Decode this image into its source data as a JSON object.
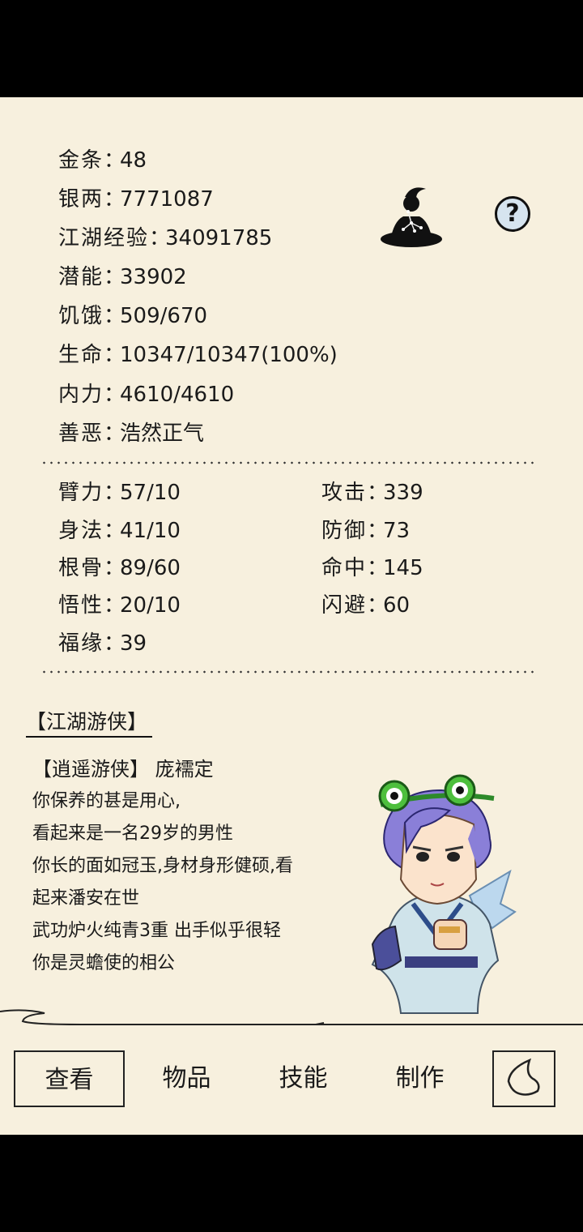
{
  "stats": {
    "gold": {
      "label": "金条",
      "value": "48"
    },
    "silver": {
      "label": "银两",
      "value": "7771087"
    },
    "exp": {
      "label": "江湖经验",
      "value": "34091785"
    },
    "potential": {
      "label": "潜能",
      "value": "33902"
    },
    "hunger": {
      "label": "饥饿",
      "value": "509/670"
    },
    "life": {
      "label": "生命",
      "value": "10347/10347(100%)"
    },
    "inner": {
      "label": "内力",
      "value": "4610/4610"
    },
    "morality": {
      "label": "善恶",
      "value": "浩然正气"
    }
  },
  "attrs": {
    "strength": {
      "label": "臂力",
      "value": "57/10"
    },
    "agility": {
      "label": "身法",
      "value": "41/10"
    },
    "constitution": {
      "label": "根骨",
      "value": "89/60"
    },
    "comprehension": {
      "label": "悟性",
      "value": "20/10"
    },
    "luck": {
      "label": "福缘",
      "value": "39"
    },
    "attack": {
      "label": "攻击",
      "value": "339"
    },
    "defense": {
      "label": "防御",
      "value": "73"
    },
    "hit": {
      "label": "命中",
      "value": "145"
    },
    "dodge": {
      "label": "闪避",
      "value": "60"
    }
  },
  "separator": "：",
  "help_symbol": "?",
  "section_title": "【江湖游侠】",
  "profile": {
    "line1": "【逍遥游侠】 庞襦定",
    "line2": "你保养的甚是用心,",
    "line3": "看起来是一名29岁的男性",
    "line4": "你长的面如冠玉,身材身形健硕,看",
    "line5": "起来潘安在世",
    "line6": "武功炉火纯青3重 出手似乎很轻",
    "line7": "你是灵蟾使的相公"
  },
  "nav": {
    "view": "查看",
    "items": "物品",
    "skills": "技能",
    "craft": "制作"
  },
  "icons": {
    "meditate": "meditate-icon",
    "help": "help-icon",
    "back": "back-icon"
  }
}
